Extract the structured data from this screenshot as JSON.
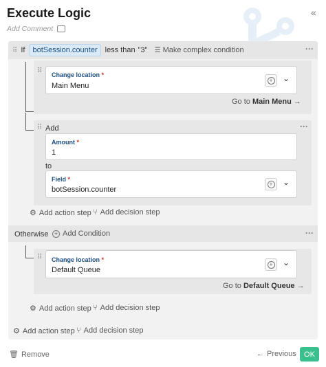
{
  "header": {
    "title": "Execute Logic",
    "add_comment": "Add Comment",
    "collapse_glyph": "«"
  },
  "if_row": {
    "if_label": "If",
    "variable": "botSession.counter",
    "operator": "less than",
    "value": "\"3\"",
    "complex_link": "Make complex condition"
  },
  "if_branch": {
    "change_location": {
      "label": "Change location",
      "required": "*",
      "value": "Main Menu",
      "goto_prefix": "Go to",
      "goto_target": "Main Menu"
    },
    "add": {
      "label": "Add",
      "amount_label": "Amount",
      "amount_value": "1",
      "to_label": "to",
      "field_label": "Field",
      "field_value": "botSession.counter",
      "required": "*"
    },
    "add_action": "Add action step",
    "add_decision": "Add decision step"
  },
  "otherwise": {
    "label": "Otherwise",
    "add_condition": "Add Condition",
    "change_location": {
      "label": "Change location",
      "required": "*",
      "value": "Default Queue",
      "goto_prefix": "Go to",
      "goto_target": "Default Queue"
    },
    "add_action": "Add action step",
    "add_decision": "Add decision step"
  },
  "outer": {
    "add_action": "Add action step",
    "add_decision": "Add decision step"
  },
  "footer": {
    "remove": "Remove",
    "previous": "Previous",
    "ok": "OK"
  },
  "colors": {
    "pill_bg": "#dbeaf7",
    "label_blue": "#1b4c82",
    "ok_green": "#3bbf8f",
    "required_red": "#c0392b"
  }
}
